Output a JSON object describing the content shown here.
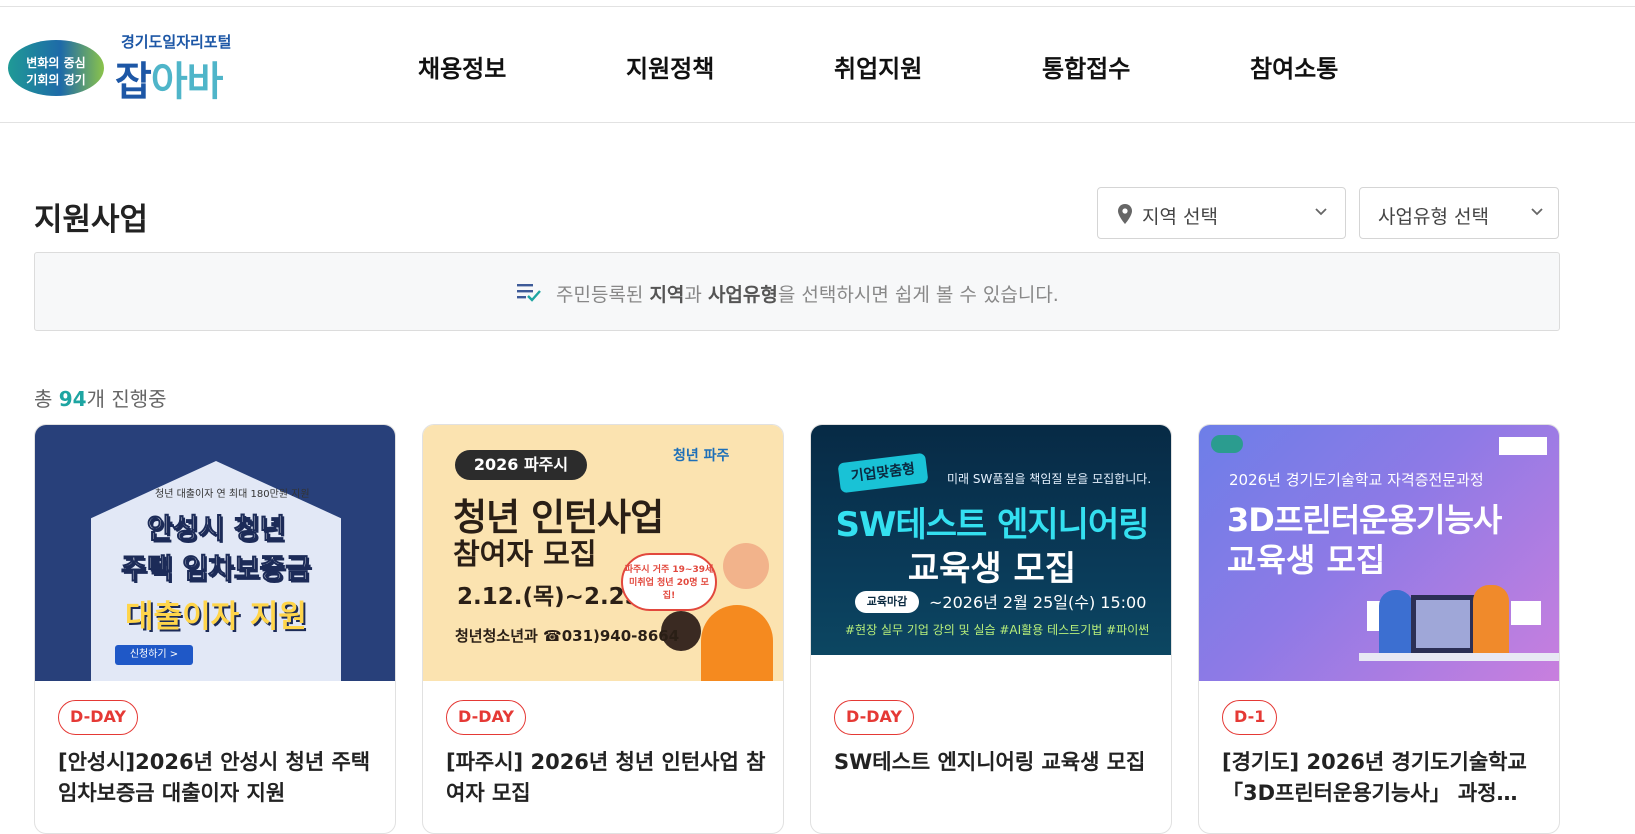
{
  "header": {
    "logo": {
      "slogan_line1": "변화의 중심",
      "slogan_line2": "기회의 경기",
      "portal_name": "경기도일자리포털",
      "brand_part1": "잡",
      "brand_part2": "아바"
    },
    "nav": [
      "채용정보",
      "지원정책",
      "취업지원",
      "통합접수",
      "참여소통"
    ]
  },
  "page": {
    "title": "지원사업",
    "filters": {
      "region": {
        "label": "지역 선택",
        "icon": "map-pin-icon"
      },
      "type": {
        "label": "사업유형 선택"
      }
    },
    "notice": {
      "icon": "checklist-icon",
      "text_pre": "주민등록된 ",
      "bold1": "지역",
      "text_mid": "과 ",
      "bold2": "사업유형",
      "text_post": "을 선택하시면 쉽게 볼 수 있습니다."
    },
    "summary": {
      "prefix": "총 ",
      "count": "94",
      "suffix": "개 진행중"
    }
  },
  "cards": [
    {
      "badge": "D-DAY",
      "title": "[안성시]2026년 안성시 청년 주택 임차보증금 대출이자 지원",
      "thumb": {
        "small": "청년 대출이자 연 최대 180만원 지원",
        "line1": "안성시 청년",
        "line2": "주택 임차보증금",
        "line3": "대출이자 지원",
        "button": "신청하기 >"
      }
    },
    {
      "badge": "D-DAY",
      "title": "[파주시] 2026년 청년 인턴사업 참여자 모집",
      "thumb": {
        "year": "2026 파주시",
        "brand": "청년 파주",
        "line1": "청년 인턴사업",
        "line2": "참여자 모집",
        "date": "2.12.(목)~2.25.(수)",
        "bubble": "파주시 거주 19~39세 미취업 청년 20명 모집!",
        "contact": "청년청소년과 ☎031)940-8664"
      }
    },
    {
      "badge": "D-DAY",
      "title": "SW테스트 엔지니어링 교육생 모집",
      "thumb": {
        "tag": "기업맞춤형",
        "sub": "미래 SW품질을 책임질 분을 모집합니다.",
        "line1": "SW테스트 엔지니어링",
        "line2": "교육생 모집",
        "deadline_pill": "교육마감",
        "deadline": "~2026년 2월 25일(수) 15:00",
        "tags": "#현장 실무 기업 강의 및 실습 #AI활용 테스트기법 #파이썬"
      }
    },
    {
      "badge": "D-1",
      "title": "[경기도] 2026년 경기도기술학교 「3D프린터운용기능사」 과정…",
      "thumb": {
        "sub": "2026년 경기도기술학교 자격증전문과정",
        "line1": "3D프린터운용기능사",
        "line2": "교육생 모집"
      }
    }
  ],
  "colors": {
    "accent_teal": "#1ea5a2",
    "badge_red": "#e53935",
    "brand_blue": "#1d57a6"
  }
}
